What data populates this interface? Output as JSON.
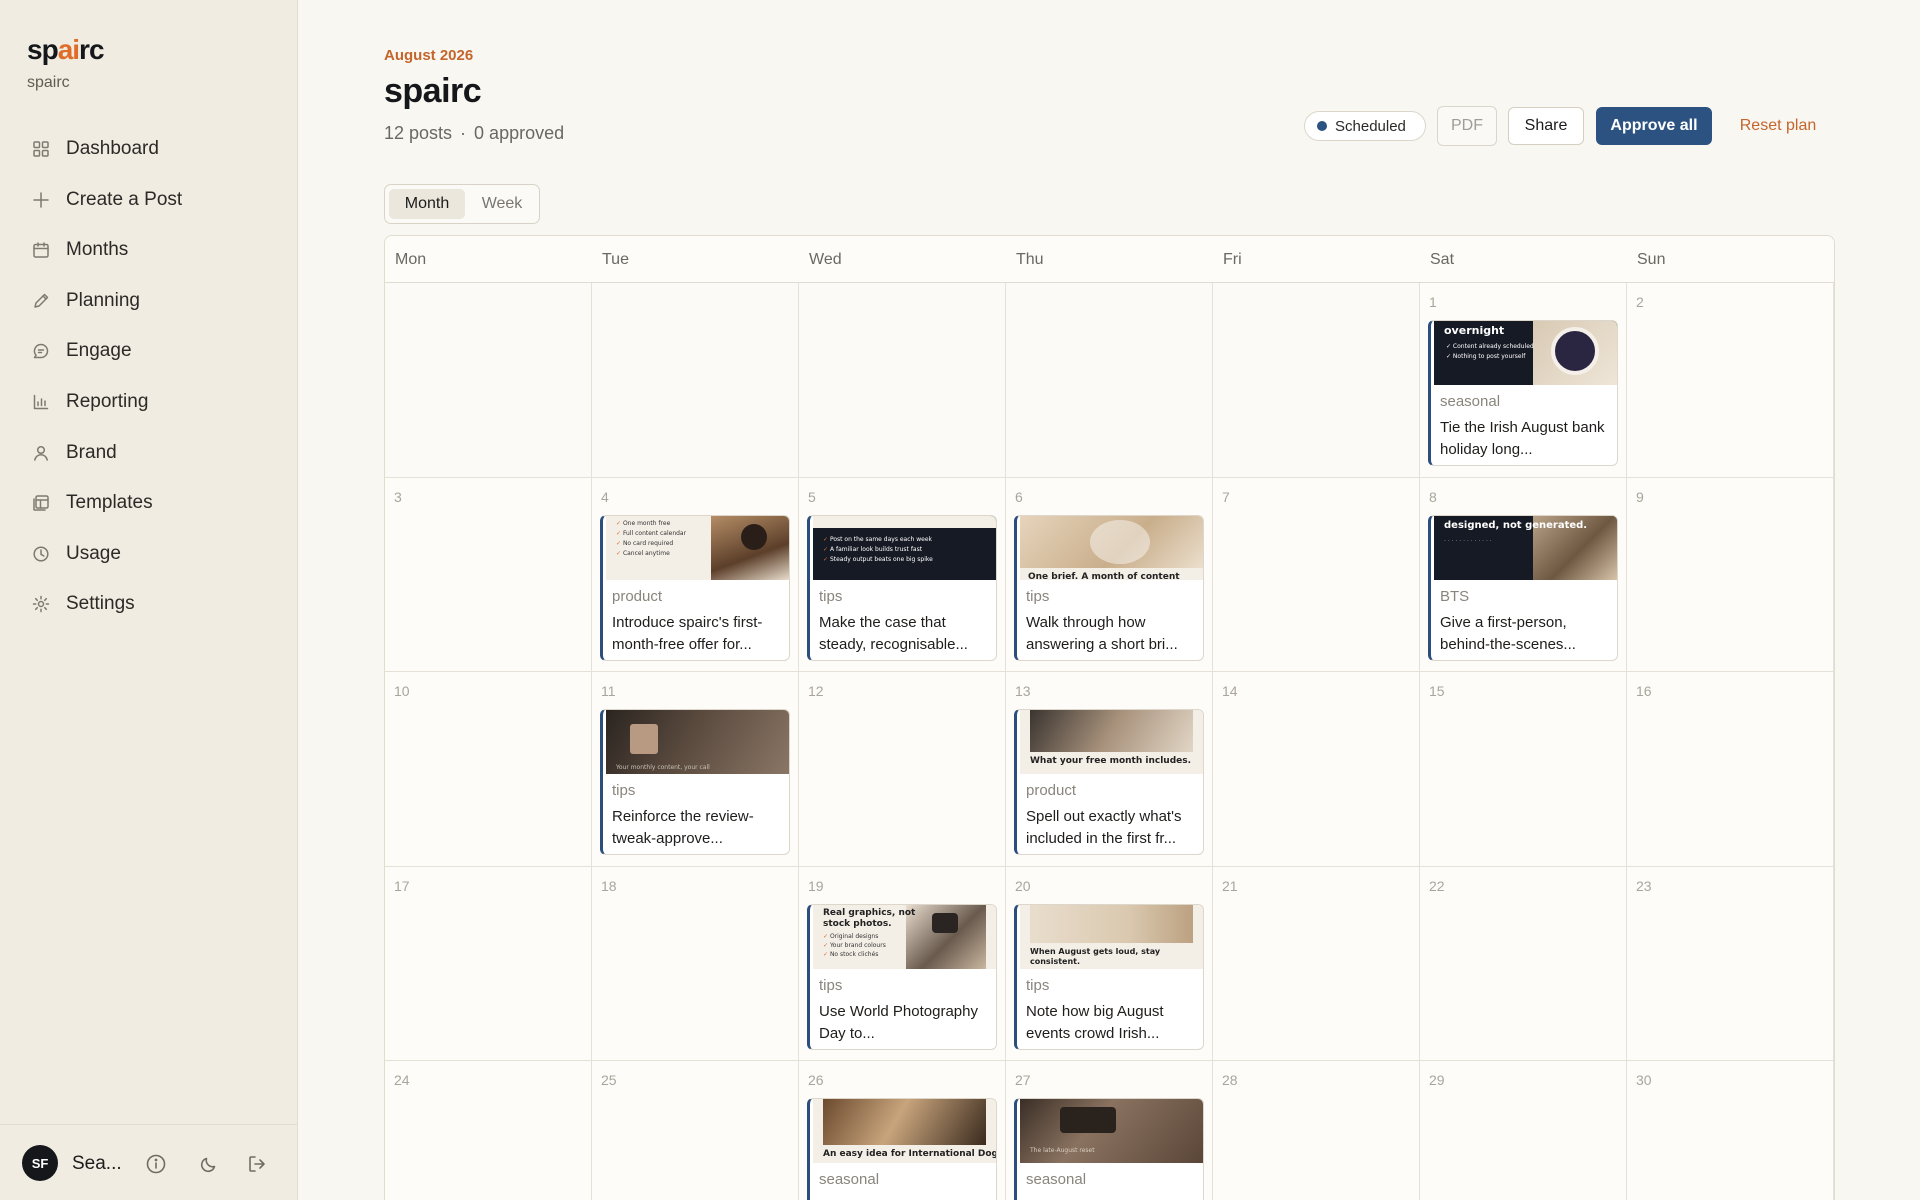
{
  "app": {
    "logo_left": "sp",
    "logo_accent": "ai",
    "logo_right": "rc",
    "workspace": "spairc"
  },
  "sidebar": {
    "items": [
      {
        "label": "Dashboard",
        "icon": "grid-icon"
      },
      {
        "label": "Create a Post",
        "icon": "plus-icon"
      },
      {
        "label": "Months",
        "icon": "calendar-icon"
      },
      {
        "label": "Planning",
        "icon": "pencil-icon"
      },
      {
        "label": "Engage",
        "icon": "chat-icon"
      },
      {
        "label": "Reporting",
        "icon": "bar-chart-icon"
      },
      {
        "label": "Brand",
        "icon": "user-icon"
      },
      {
        "label": "Templates",
        "icon": "templates-icon"
      },
      {
        "label": "Usage",
        "icon": "clock-icon"
      },
      {
        "label": "Settings",
        "icon": "gear-icon"
      }
    ],
    "footer": {
      "avatar_initials": "SF",
      "user_name": "Sea..."
    }
  },
  "header": {
    "month_label": "August 2026",
    "title": "spairc",
    "posts_count": "12 posts",
    "separator": "·",
    "approved_count": "0 approved",
    "status": "Scheduled",
    "pdf_label": "PDF",
    "share_label": "Share",
    "approve_all_label": "Approve all",
    "reset_label": "Reset plan"
  },
  "view_toggle": {
    "month": "Month",
    "week": "Week",
    "selected": "Month"
  },
  "calendar": {
    "weekdays": [
      "Mon",
      "Tue",
      "Wed",
      "Thu",
      "Fri",
      "Sat",
      "Sun"
    ],
    "weeks": [
      [
        null,
        null,
        null,
        null,
        null,
        1,
        2
      ],
      [
        3,
        4,
        5,
        6,
        7,
        8,
        9
      ],
      [
        10,
        11,
        12,
        13,
        14,
        15,
        16
      ],
      [
        17,
        18,
        19,
        20,
        21,
        22,
        23
      ],
      [
        24,
        25,
        26,
        27,
        28,
        29,
        30
      ]
    ],
    "posts": {
      "1": {
        "category": "seasonal",
        "text": "Tie the Irish August bank holiday long...",
        "thumb_title": "overnight",
        "thumb_lines": [
          "Content already scheduled",
          "Nothing to post yourself"
        ]
      },
      "4": {
        "category": "product",
        "text": "Introduce spairc's first-month-free offer for...",
        "thumb_lines": [
          "One month free",
          "Full content calendar",
          "No card required",
          "Cancel anytime"
        ]
      },
      "5": {
        "category": "tips",
        "text": "Make the case that steady, recognisable...",
        "thumb_lines": [
          "Post on the same days each week",
          "A familiar look builds trust fast",
          "Steady output beats one big spike"
        ]
      },
      "6": {
        "category": "tips",
        "text": "Walk through how answering a short bri...",
        "thumb_title": "One brief. A month of content"
      },
      "8": {
        "category": "BTS",
        "text": "Give a first-person, behind-the-scenes...",
        "thumb_title": "designed, not generated."
      },
      "11": {
        "category": "tips",
        "text": "Reinforce the review-tweak-approve...",
        "thumb_lines": [
          "Your monthly content, your call"
        ]
      },
      "13": {
        "category": "product",
        "text": "Spell out exactly what's included in the first fr...",
        "thumb_title": "What your free month includes."
      },
      "19": {
        "category": "tips",
        "text": "Use World Photography Day to...",
        "thumb_title": "Real graphics, not stock photos.",
        "thumb_lines": [
          "Original designs",
          "Your brand colours",
          "No stock clichés"
        ]
      },
      "20": {
        "category": "tips",
        "text": "Note how big August events crowd Irish...",
        "thumb_title": "When August gets loud, stay consistent."
      },
      "26": {
        "category": "seasonal",
        "text": "",
        "thumb_title": "An easy idea for International Dog"
      },
      "27": {
        "category": "seasonal",
        "text": "",
        "thumb_lines": [
          "The late-August reset"
        ]
      }
    }
  },
  "colors": {
    "accent_orange": "#c4652c",
    "primary_blue": "#2c5282",
    "post_border": "#2c4e7c",
    "sidebar_bg": "#f1ece1"
  }
}
